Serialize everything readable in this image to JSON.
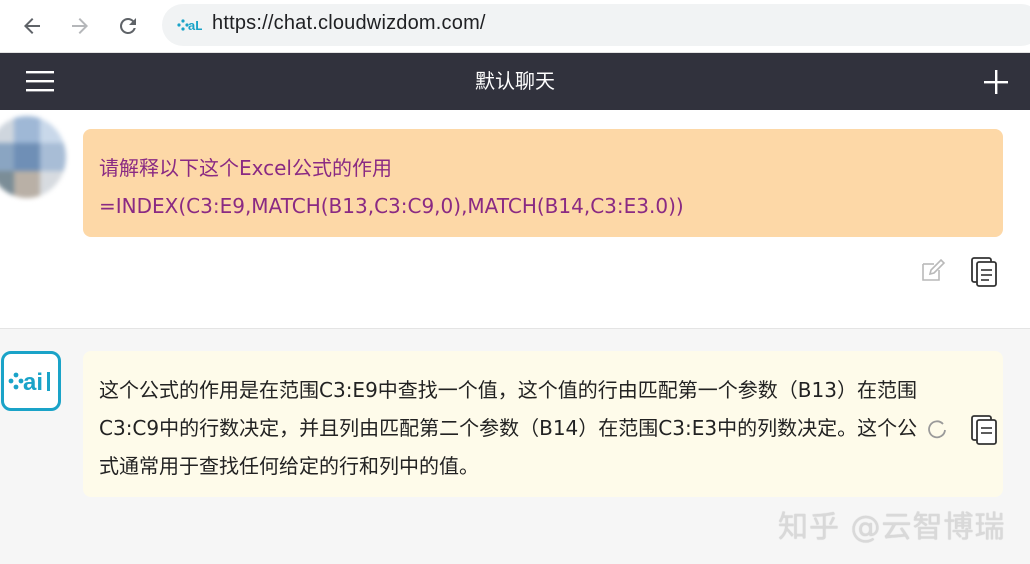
{
  "browser": {
    "url": "https://chat.cloudwizdom.com/",
    "site_icon": "cloudwizdom-ai-logo",
    "nav_icons": [
      "back-arrow-icon",
      "forward-arrow-icon",
      "reload-icon"
    ]
  },
  "header": {
    "title": "默认聊天",
    "menu_icon": "hamburger-menu-icon",
    "add_icon": "plus-icon"
  },
  "messages": [
    {
      "role": "user",
      "lines": [
        "请解释以下这个Excel公式的作用",
        "=INDEX(C3:E9,MATCH(B13,C3:C9,0),MATCH(B14,C3:E3.0))"
      ],
      "actions": [
        "edit-icon",
        "copy-icon"
      ]
    },
    {
      "role": "assistant",
      "lines": [
        "这个公式的作用是在范围C3:E9中查找一个值，这个值的行由匹配第一个参数（B13）在范围",
        "C3:C9中的行数决定，并且列由匹配第二个参数（B14）在范围C3:E3中的列数决定。这个公",
        "式通常用于查找任何给定的行和列中的值。"
      ],
      "avatar_text": "ai",
      "actions": [
        "copy-icon"
      ]
    }
  ],
  "watermark": "知乎 @云智博瑞",
  "colors": {
    "header_bg": "#31323d",
    "user_bubble_bg": "#fdd8a7",
    "user_text": "#8a2a83",
    "bot_bubble_bg": "#fefbea",
    "bot_avatar_accent": "#1aa3c8"
  }
}
